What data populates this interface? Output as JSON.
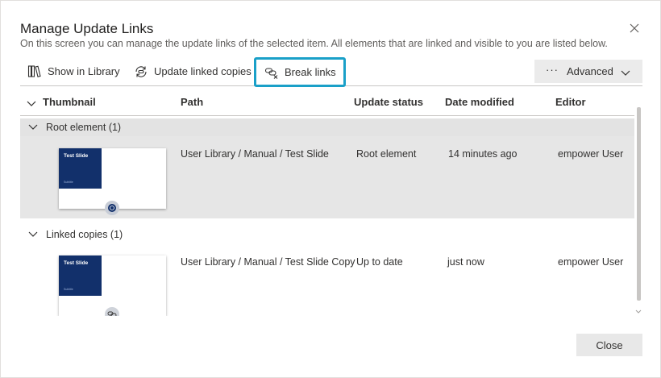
{
  "dialog": {
    "title": "Manage Update Links",
    "subtitle": "On this screen you can manage the update links of the selected item. All elements that are linked and visible to you are listed below."
  },
  "toolbar": {
    "show_in_library": "Show in Library",
    "update_linked_copies": "Update linked copies",
    "break_links": "Break links",
    "advanced": "Advanced",
    "more_dots": "···"
  },
  "columns": {
    "thumbnail": "Thumbnail",
    "path": "Path",
    "update_status": "Update status",
    "date_modified": "Date modified",
    "editor": "Editor"
  },
  "groups": [
    {
      "label": "Root element (1)",
      "rows": [
        {
          "thumb_title": "Test Slide",
          "thumb_sub": "Subtitle",
          "path": "User Library / Manual / Test Slide",
          "status": "Root element",
          "date": "14 minutes ago",
          "editor": "empower User"
        }
      ]
    },
    {
      "label": "Linked copies (1)",
      "rows": [
        {
          "thumb_title": "Test Slide",
          "thumb_sub": "Subtitle",
          "path": "User Library / Manual / Test Slide Copy",
          "status": "Up to date",
          "date": "just now",
          "editor": "empower User"
        }
      ]
    }
  ],
  "footer": {
    "close": "Close"
  },
  "colors": {
    "highlight_border": "#1aa0c8",
    "thumb_blue": "#12306b",
    "selected_row": "#e6e6e6"
  }
}
